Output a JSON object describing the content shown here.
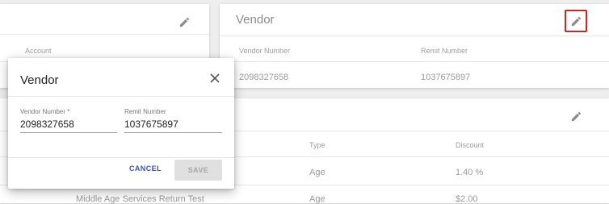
{
  "left_card": {
    "column_header": "Account"
  },
  "vendor_card": {
    "title": "Vendor",
    "columns": [
      "Vendor Number",
      "Remit Number"
    ],
    "row": [
      "2098327658",
      "1037675897"
    ]
  },
  "lower_card": {
    "columns": [
      "Type",
      "Discount"
    ],
    "rows": [
      {
        "name": "",
        "type": "Age",
        "discount": "1.40 %"
      },
      {
        "name": "Middle Age Services Return Test",
        "type": "Age",
        "discount": "$2.00"
      }
    ]
  },
  "modal": {
    "title": "Vendor",
    "vendor_number_label": "Vendor Number *",
    "vendor_number_value": "2098327658",
    "remit_number_label": "Remit Number",
    "remit_number_value": "1037675897",
    "cancel_label": "CANCEL",
    "save_label": "SAVE"
  },
  "icons": {
    "edit": "pencil-icon",
    "close": "close-icon"
  },
  "colors": {
    "accent": "#3f51b5",
    "highlight_border": "#c62828"
  }
}
